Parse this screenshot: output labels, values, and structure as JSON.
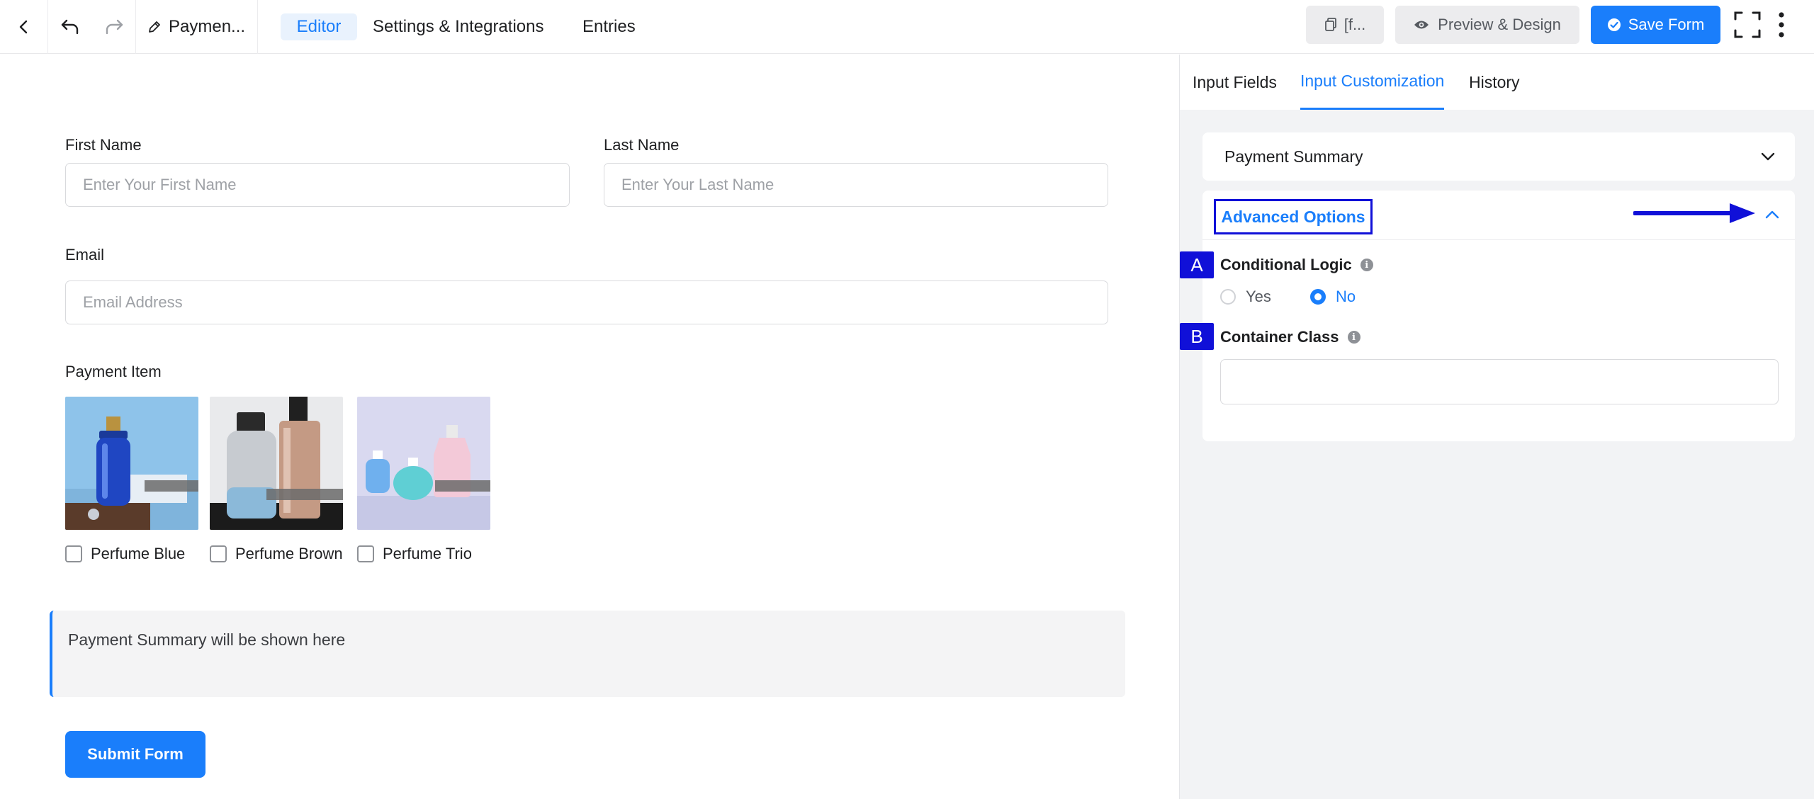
{
  "toolbar": {
    "form_title": "Paymen...",
    "tabs": {
      "editor": "Editor",
      "settings": "Settings & Integrations",
      "entries": "Entries"
    },
    "shortcode_label": "[f...",
    "preview_label": "Preview & Design",
    "save_label": "Save Form"
  },
  "form": {
    "first_name": {
      "label": "First Name",
      "placeholder": "Enter Your First Name"
    },
    "last_name": {
      "label": "Last Name",
      "placeholder": "Enter Your Last Name"
    },
    "email": {
      "label": "Email",
      "placeholder": "Email Address"
    },
    "payment_item": {
      "label": "Payment Item",
      "items": [
        {
          "label": "Perfume Blue"
        },
        {
          "label": "Perfume Brown"
        },
        {
          "label": "Perfume Trio"
        }
      ]
    },
    "summary_text": "Payment Summary will be shown here",
    "submit_label": "Submit Form"
  },
  "panel": {
    "tabs": {
      "input_fields": "Input Fields",
      "input_customization": "Input Customization",
      "history": "History"
    },
    "payment_summary_title": "Payment Summary",
    "advanced_options_title": "Advanced Options",
    "badges": {
      "a": "A",
      "b": "B"
    },
    "conditional_logic": {
      "label": "Conditional Logic",
      "options": {
        "yes": "Yes",
        "no": "No"
      },
      "selected": "No"
    },
    "container_class": {
      "label": "Container Class",
      "value": ""
    }
  },
  "colors": {
    "accent": "#1a7efb",
    "annotation": "#1010d8"
  }
}
